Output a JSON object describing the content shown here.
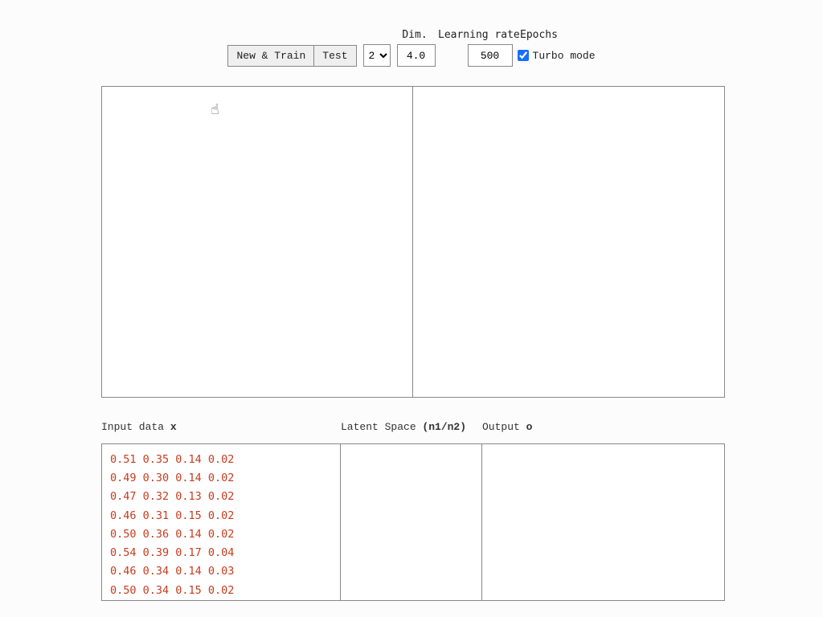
{
  "controls": {
    "new_train_label": "New & Train",
    "test_label": "Test",
    "dim_label": "Dim.",
    "dim_value": "2",
    "dim_options": [
      "1",
      "2",
      "3",
      "4"
    ],
    "lr_label": "Learning rate",
    "lr_value": "4.0",
    "epochs_label": "Epochs",
    "epochs_value": "500",
    "turbo_label": "Turbo mode",
    "turbo_checked": true
  },
  "sections": {
    "input_label_prefix": "Input data ",
    "input_label_var": "x",
    "latent_label_prefix": "Latent Space ",
    "latent_label_var": "(n1/n2)",
    "output_label_prefix": "Output ",
    "output_label_var": "o"
  },
  "input_data": [
    "0.51 0.35 0.14 0.02",
    "0.49 0.30 0.14 0.02",
    "0.47 0.32 0.13 0.02",
    "0.46 0.31 0.15 0.02",
    "0.50 0.36 0.14 0.02",
    "0.54 0.39 0.17 0.04",
    "0.46 0.34 0.14 0.03",
    "0.50 0.34 0.15 0.02"
  ],
  "latent_data": [],
  "output_data": []
}
